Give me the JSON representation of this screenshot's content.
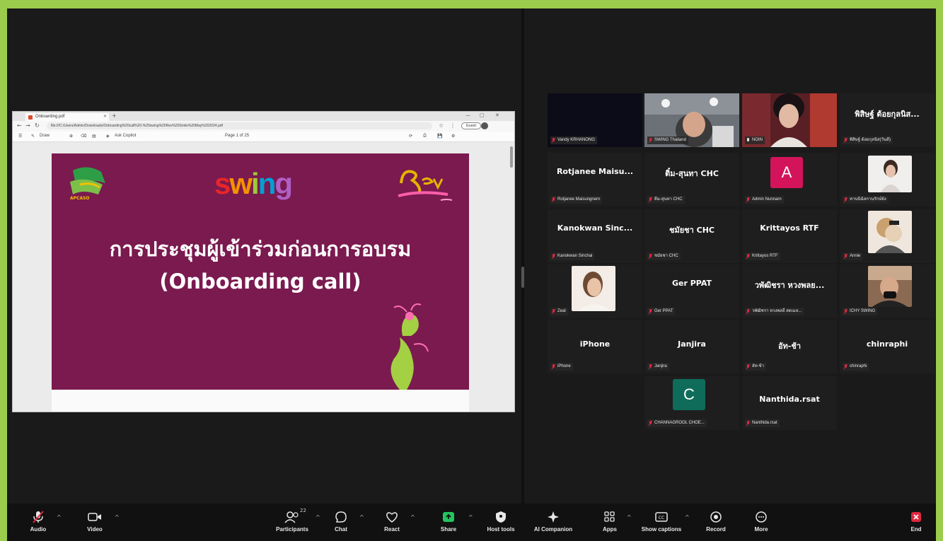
{
  "colors": {
    "accent_frame": "#9ccc4c",
    "slide_bg": "#7a1a4f",
    "speaking_border": "#2ecc71",
    "end_red": "#e0263d"
  },
  "browser": {
    "tab_title": "Onboarding.pdf",
    "address": "file:///C:/Users/Admin/Downloads/Onboarding%20call%20-%20swing%20Rev%20Smile%20May%202024.pdf",
    "profile_label": "Guest",
    "pdf_tools": [
      "Draw",
      "Ask Copilot",
      "Page 1 of 25"
    ]
  },
  "slide": {
    "logo_left_text": "APCASO",
    "logo_center": "swing",
    "title": "การประชุมผู้เข้าร่วมก่อนการอบรม",
    "subtitle": "(Onboarding call)"
  },
  "participants": {
    "row1": [
      {
        "label": "Vandy KRHANONG",
        "name": "",
        "type": "dark"
      },
      {
        "label": "SWING Thailand",
        "name": "",
        "type": "video"
      },
      {
        "label": "NOIN",
        "name": "",
        "type": "video-speaking"
      },
      {
        "label": "พิสิษฐ์ ต้อยกุลนิส(วันดี)",
        "name": "พิสิษฐ์ ต้อยกุลนิส...",
        "type": "name"
      }
    ],
    "row2": [
      {
        "label": "Rotjanee Maisungnern",
        "name": "Rotjanee Maisu...",
        "type": "name"
      },
      {
        "label": "ติ๋ม-สุนทา CHC",
        "name": "ติ๋ม-สุนทา CHC",
        "type": "name"
      },
      {
        "label": "Admin Nunnarn",
        "name": "",
        "type": "letter",
        "letter": "A",
        "color": "#d3145a"
      },
      {
        "label": "ทานนิฉัลกานรักษ์ยัง",
        "name": "",
        "type": "photo"
      }
    ],
    "row3": [
      {
        "label": "Kanokwan Sinchai",
        "name": "Kanokwan Sinc...",
        "type": "name"
      },
      {
        "label": "ชมัยชา CHC",
        "name": "ชมัยชา CHC",
        "type": "name"
      },
      {
        "label": "Krittayos RTF",
        "name": "Krittayos RTF",
        "type": "name"
      },
      {
        "label": "Annie",
        "name": "",
        "type": "photo"
      }
    ],
    "row4": [
      {
        "label": "Zeal",
        "name": "",
        "type": "photo"
      },
      {
        "label": "Ger PPAT",
        "name": "Ger PPAT",
        "type": "name"
      },
      {
        "label": "วพัฒิชรา หวงพลยี่ สดเมล...",
        "name": "วพัฒิชรา หวงพลย...",
        "type": "name"
      },
      {
        "label": "ICHY SWING",
        "name": "",
        "type": "photo"
      }
    ],
    "row5": [
      {
        "label": "iPhone",
        "name": "iPhone",
        "type": "name"
      },
      {
        "label": "Janjira",
        "name": "Janjira",
        "type": "name"
      },
      {
        "label": "อัท-ช้า",
        "name": "อัท-ช้า",
        "type": "name"
      },
      {
        "label": "chinraphi",
        "name": "chinraphi",
        "type": "name"
      }
    ],
    "row6": [
      {
        "label": "CHANNAGROOL CHOE...",
        "name": "",
        "type": "letter",
        "letter": "C",
        "color": "#0f6c5a"
      },
      {
        "label": "Nanthida.rsat",
        "name": "Nanthida.rsat",
        "type": "name"
      }
    ]
  },
  "toolbar": {
    "audio": "Audio",
    "video": "Video",
    "participants": "Participants",
    "participants_count": "22",
    "chat": "Chat",
    "react": "React",
    "share": "Share",
    "host_tools": "Host tools",
    "ai_companion": "AI Companion",
    "apps": "Apps",
    "captions": "Show captions",
    "record": "Record",
    "more": "More",
    "end": "End"
  }
}
